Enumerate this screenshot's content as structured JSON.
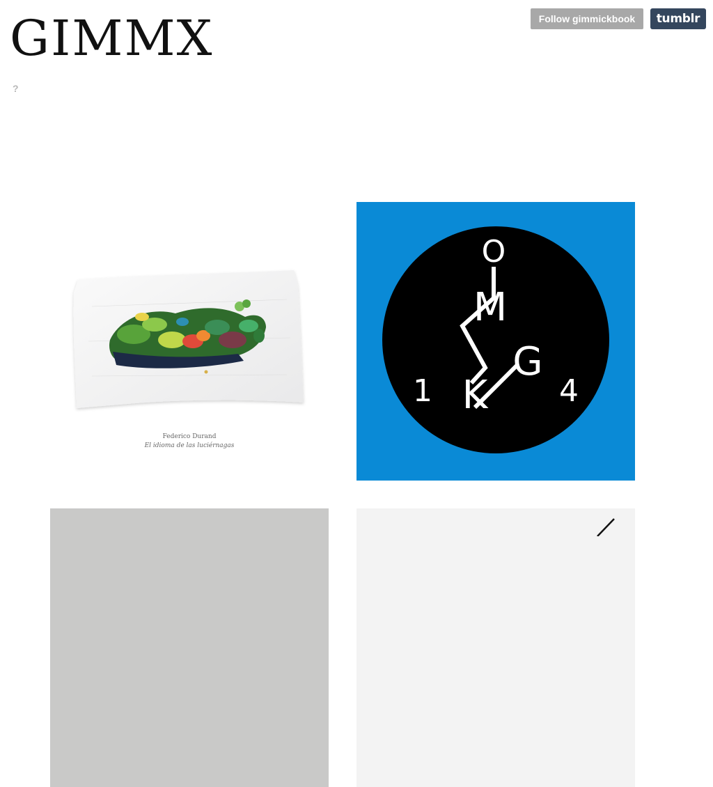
{
  "blog": {
    "title": "GIMMX",
    "help_link": "?"
  },
  "controls": {
    "follow_label": "Follow gimmickbook",
    "tumblr_label": "tumblr"
  },
  "posts": [
    {
      "type": "photo",
      "image": "embroidered-landscape-album-cover",
      "caption_author": "Federico Durand",
      "caption_title": "El idioma de las luciérnagas"
    },
    {
      "type": "photo",
      "image": "omg-logo-circle",
      "background": "#0a8ad6",
      "logo_letters": {
        "top": "O",
        "middle": "M",
        "right": "G",
        "bottom": "K",
        "left_number": "1",
        "right_number": "4"
      }
    },
    {
      "type": "photo",
      "image": "grey-cover-partial"
    },
    {
      "type": "photo",
      "image": "line-drawing-partial"
    }
  ],
  "colors": {
    "follow_bg": "#a8a8a8",
    "tumblr_bg": "#34465d",
    "help_text": "#b8b8b8"
  }
}
